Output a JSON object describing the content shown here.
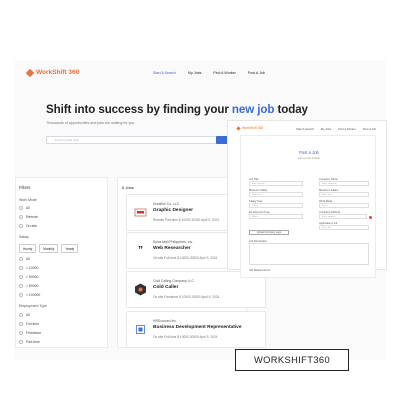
{
  "header": {
    "logo_text": "WorkShift 360",
    "nav": [
      "Start A Search",
      "My Jobs",
      "Find A Worker",
      "Post A Job"
    ]
  },
  "hero": {
    "headline_before": "Shift into success by finding your ",
    "headline_accent": "new job",
    "headline_after": " today",
    "subtitle": "Thousands of opportunities and jobs are waiting for you.",
    "search_placeholder": "Look for jobs here",
    "search_button": "Search"
  },
  "filters": {
    "title": "Filters",
    "work_mode": {
      "label": "Work Mode",
      "options": [
        "All",
        "Remote",
        "On-site"
      ]
    },
    "salary": {
      "label": "Salary",
      "chips": [
        "Hourly",
        "Monthly",
        "Yearly"
      ],
      "options": [
        "All",
        "> 10000",
        "> 50000",
        "> 80000",
        "> 100000"
      ]
    },
    "employment_type": {
      "label": "Employment Type",
      "options": [
        "All",
        "Full-time",
        "Freelance",
        "Part-time"
      ]
    }
  },
  "jobs": {
    "count_label": "6 Jobs",
    "list": [
      {
        "company": "Duraflon Co. LLC",
        "title": "Graphic Designer",
        "meta": "Remote  Part-time  $ 10000-30000  April 9, 2024",
        "icon": "company-logo"
      },
      {
        "company": "Sylva Mall Philippines, Inc.",
        "title": "Web Researcher",
        "meta": "On-site  Full-time  $ 10000-30000  April 9, 2024",
        "icon": "quote-logo"
      },
      {
        "company": "Cold Calling Company LLC",
        "title": "Cold Caller",
        "meta": "On-site  Freelance  $ 10000-30000  April 9, 2024",
        "icon": "hexagon-logo"
      },
      {
        "company": "HRSourced Inc.",
        "title": "Business Development Representative",
        "meta": "On-site  Full-time  $ 10000-30000  April 9, 2024",
        "icon": "square-logo"
      }
    ]
  },
  "post_job": {
    "logo_text": "WorkShift 360",
    "nav": [
      "Start A Search",
      "My Jobs",
      "Find A Worker",
      "Post A Job"
    ],
    "title": "Post a Job",
    "subtitle": "Fill out the details",
    "fields": [
      {
        "label": "Job Title",
        "placeholder": "Enter job title"
      },
      {
        "label": "Company Name",
        "placeholder": "Enter company"
      },
      {
        "label": "Minimum Salary",
        "placeholder": "Enter min"
      },
      {
        "label": "Maximum Salary",
        "placeholder": "Enter max"
      },
      {
        "label": "Salary Type",
        "placeholder": "Select"
      },
      {
        "label": "Work Mode",
        "placeholder": "Select"
      },
      {
        "label": "Employment Type",
        "placeholder": "Select"
      },
      {
        "label": "Company Address",
        "placeholder": "Enter address"
      },
      {
        "label": "Application Link",
        "placeholder": "Enter link"
      }
    ],
    "upload_label": "Upload Company Logo",
    "description_label": "Job Description",
    "requirements_label": "Job Requirements"
  },
  "brand_box": "WORKSHIFT360",
  "colors": {
    "brand_orange": "#e8703a",
    "accent_blue": "#3b6cd9"
  }
}
